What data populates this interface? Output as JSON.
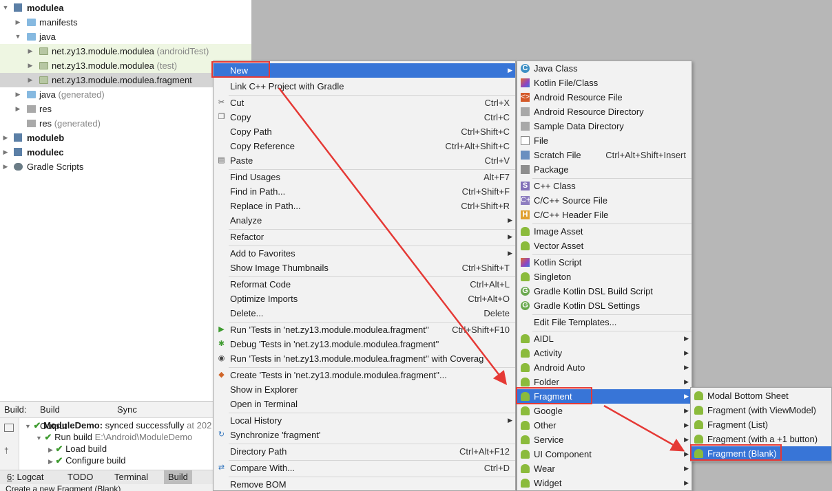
{
  "project_tree": {
    "items": [
      {
        "label": "modulea",
        "suffix": ""
      },
      {
        "label": "manifests",
        "suffix": ""
      },
      {
        "label": "java",
        "suffix": ""
      },
      {
        "label": "net.zy13.module.modulea",
        "suffix": "(androidTest)"
      },
      {
        "label": "net.zy13.module.modulea",
        "suffix": "(test)"
      },
      {
        "label": "net.zy13.module.modulea.fragment",
        "suffix": ""
      },
      {
        "label": "java",
        "suffix": "(generated)"
      },
      {
        "label": "res",
        "suffix": ""
      },
      {
        "label": "res",
        "suffix": "(generated)"
      },
      {
        "label": "moduleb",
        "suffix": ""
      },
      {
        "label": "modulec",
        "suffix": ""
      },
      {
        "label": "Gradle Scripts",
        "suffix": ""
      }
    ]
  },
  "build_panel": {
    "label": "Build:",
    "tabs": [
      "Build Output",
      "Sync"
    ],
    "close_glyph": "×",
    "rows": [
      {
        "name": "ModuleDemo:",
        "text": "synced successfully",
        "extra": "at 202"
      },
      {
        "name": "Run build",
        "text": "",
        "extra": "E:\\Android\\ModuleDemo"
      },
      {
        "name": "Load build",
        "text": "",
        "extra": ""
      },
      {
        "name": "Configure build",
        "text": "",
        "extra": ""
      }
    ]
  },
  "tool_windows": [
    {
      "num": "6",
      "label": ": Logcat"
    },
    {
      "num": "",
      "label": "TODO"
    },
    {
      "num": "",
      "label": "Terminal"
    },
    {
      "num": "",
      "label": "Build"
    }
  ],
  "status_bar": {
    "text": "Create a new Fragment (Blank)"
  },
  "context_menu": {
    "items": [
      {
        "label": "New",
        "shortcut": ""
      },
      {
        "label": "Link C++ Project with Gradle",
        "shortcut": ""
      },
      {
        "label": "Cut",
        "shortcut": "Ctrl+X"
      },
      {
        "label": "Copy",
        "shortcut": "Ctrl+C"
      },
      {
        "label": "Copy Path",
        "shortcut": "Ctrl+Shift+C"
      },
      {
        "label": "Copy Reference",
        "shortcut": "Ctrl+Alt+Shift+C"
      },
      {
        "label": "Paste",
        "shortcut": "Ctrl+V"
      },
      {
        "label": "Find Usages",
        "shortcut": "Alt+F7"
      },
      {
        "label": "Find in Path...",
        "shortcut": "Ctrl+Shift+F"
      },
      {
        "label": "Replace in Path...",
        "shortcut": "Ctrl+Shift+R"
      },
      {
        "label": "Analyze",
        "shortcut": ""
      },
      {
        "label": "Refactor",
        "shortcut": ""
      },
      {
        "label": "Add to Favorites",
        "shortcut": ""
      },
      {
        "label": "Show Image Thumbnails",
        "shortcut": "Ctrl+Shift+T"
      },
      {
        "label": "Reformat Code",
        "shortcut": "Ctrl+Alt+L"
      },
      {
        "label": "Optimize Imports",
        "shortcut": "Ctrl+Alt+O"
      },
      {
        "label": "Delete...",
        "shortcut": "Delete"
      },
      {
        "label": "Run 'Tests in 'net.zy13.module.modulea.fragment''",
        "shortcut": "Ctrl+Shift+F10"
      },
      {
        "label": "Debug 'Tests in 'net.zy13.module.modulea.fragment''",
        "shortcut": ""
      },
      {
        "label": "Run 'Tests in 'net.zy13.module.modulea.fragment'' with Coverag",
        "shortcut": ""
      },
      {
        "label": "Create 'Tests in 'net.zy13.module.modulea.fragment''...",
        "shortcut": ""
      },
      {
        "label": "Show in Explorer",
        "shortcut": ""
      },
      {
        "label": "Open in Terminal",
        "shortcut": ""
      },
      {
        "label": "Local History",
        "shortcut": ""
      },
      {
        "label": "Synchronize 'fragment'",
        "shortcut": ""
      },
      {
        "label": "Directory Path",
        "shortcut": "Ctrl+Alt+F12"
      },
      {
        "label": "Compare With...",
        "shortcut": "Ctrl+D"
      },
      {
        "label": "Remove BOM",
        "shortcut": ""
      }
    ]
  },
  "new_submenu": {
    "items": [
      {
        "label": "Java Class",
        "shortcut": ""
      },
      {
        "label": "Kotlin File/Class",
        "shortcut": ""
      },
      {
        "label": "Android Resource File",
        "shortcut": ""
      },
      {
        "label": "Android Resource Directory",
        "shortcut": ""
      },
      {
        "label": "Sample Data Directory",
        "shortcut": ""
      },
      {
        "label": "File",
        "shortcut": ""
      },
      {
        "label": "Scratch File",
        "shortcut": "Ctrl+Alt+Shift+Insert"
      },
      {
        "label": "Package",
        "shortcut": ""
      },
      {
        "label": "C++ Class",
        "shortcut": ""
      },
      {
        "label": "C/C++ Source File",
        "shortcut": ""
      },
      {
        "label": "C/C++ Header File",
        "shortcut": ""
      },
      {
        "label": "Image Asset",
        "shortcut": ""
      },
      {
        "label": "Vector Asset",
        "shortcut": ""
      },
      {
        "label": "Kotlin Script",
        "shortcut": ""
      },
      {
        "label": "Singleton",
        "shortcut": ""
      },
      {
        "label": "Gradle Kotlin DSL Build Script",
        "shortcut": ""
      },
      {
        "label": "Gradle Kotlin DSL Settings",
        "shortcut": ""
      },
      {
        "label": "Edit File Templates...",
        "shortcut": ""
      },
      {
        "label": "AIDL",
        "shortcut": ""
      },
      {
        "label": "Activity",
        "shortcut": ""
      },
      {
        "label": "Android Auto",
        "shortcut": ""
      },
      {
        "label": "Folder",
        "shortcut": ""
      },
      {
        "label": "Fragment",
        "shortcut": ""
      },
      {
        "label": "Google",
        "shortcut": ""
      },
      {
        "label": "Other",
        "shortcut": ""
      },
      {
        "label": "Service",
        "shortcut": ""
      },
      {
        "label": "UI Component",
        "shortcut": ""
      },
      {
        "label": "Wear",
        "shortcut": ""
      },
      {
        "label": "Widget",
        "shortcut": ""
      }
    ]
  },
  "fragment_submenu": {
    "items": [
      {
        "label": "Modal Bottom Sheet"
      },
      {
        "label": "Fragment (with ViewModel)"
      },
      {
        "label": "Fragment (List)"
      },
      {
        "label": "Fragment (with a +1 button)"
      },
      {
        "label": "Fragment (Blank)"
      }
    ]
  },
  "icons": {
    "expanded": "▼",
    "collapsed": "▶",
    "submenu": "▶",
    "check": "✔",
    "scissors": "✂",
    "copy": "❐",
    "paste": "▤",
    "play": "▶",
    "bug": "✱",
    "shield": "◉",
    "create": "◆",
    "sync": "↻",
    "compare": "⇄",
    "class_c": "C",
    "cpp_s": "S",
    "cpps": "C++",
    "header": "H",
    "res": "<>",
    "gradle_g": "G"
  },
  "colors": {
    "highlight": "#3875d7",
    "annotation": "#e53935",
    "editor_bg": "#b7b7b7"
  }
}
